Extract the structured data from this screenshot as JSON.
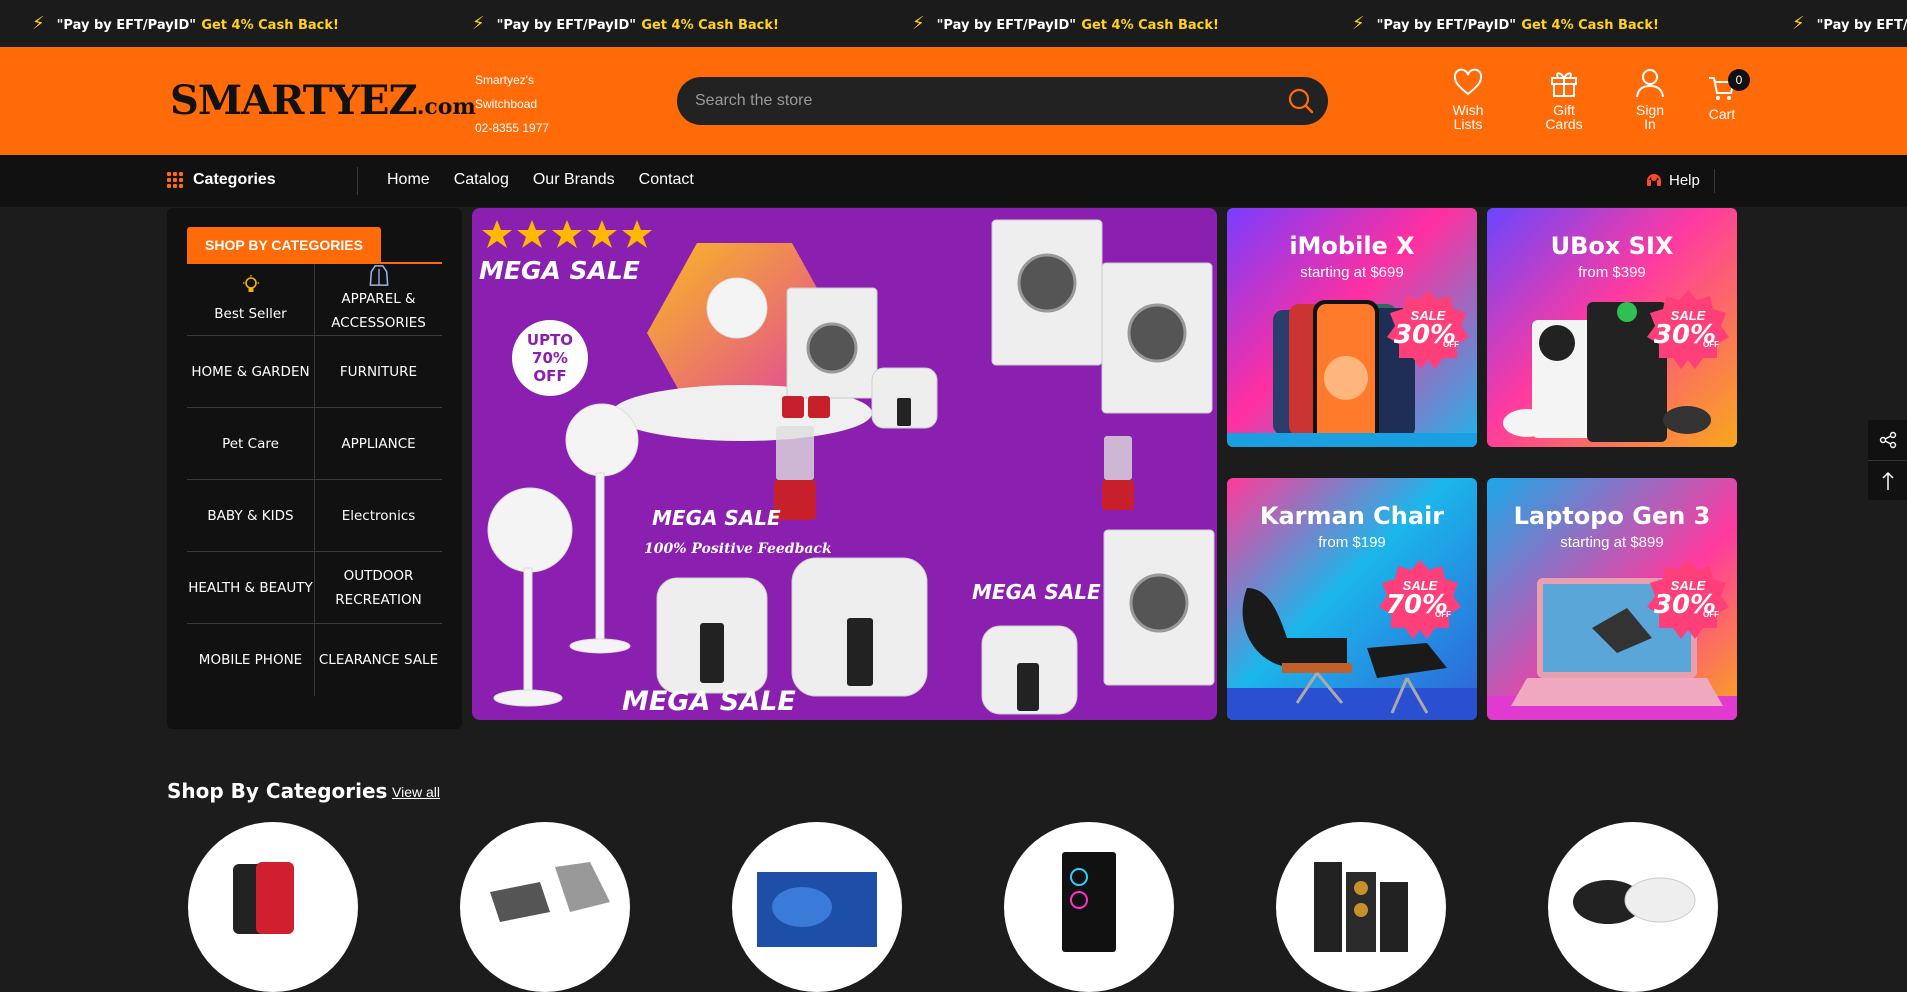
{
  "announcement": {
    "quote_text": "\"Pay by EFT/PayID\"",
    "highlight_text": "Get 4% Cash Back!"
  },
  "header": {
    "logo_main": "SMARTYEZ",
    "logo_suffix": ".com",
    "switchboard_line1": "Smartyez's",
    "switchboard_line2": "Switchboad",
    "switchboard_phone": "02-8355 1977",
    "search_placeholder": "Search the store",
    "wish_line1": "Wish",
    "wish_line2": "Lists",
    "gift_line1": "Gift",
    "gift_line2": "Cards",
    "sign_line1": "Sign",
    "sign_line2": "In",
    "cart_label": "Cart",
    "cart_count": "0"
  },
  "nav": {
    "categories_label": "Categories",
    "menu": [
      "Home",
      "Catalog",
      "Our Brands",
      "Contact"
    ],
    "help_label": "Help"
  },
  "category_panel": {
    "tab_label": "SHOP BY CATEGORIES",
    "items": [
      "Best Seller",
      "APPAREL & ACCESSORIES",
      "HOME & GARDEN",
      "FURNITURE",
      "Pet Care",
      "APPLIANCE",
      "BABY & KIDS",
      "Electronics",
      "HEALTH & BEAUTY",
      "OUTDOOR RECREATION",
      "MOBILE PHONE",
      "CLEARANCE SALE"
    ]
  },
  "hero": {
    "mega_sale": "MEGA SALE",
    "upto_line1": "UPTO",
    "upto_line2": "70%",
    "upto_line3": "OFF",
    "feedback": "100% Positive Feedback"
  },
  "promos": [
    {
      "title": "iMobile X",
      "sub": "starting at $699",
      "sale_label": "SALE",
      "sale_pct": "30%",
      "sale_off": "OFF"
    },
    {
      "title": "UBox SIX",
      "sub": "from $399",
      "sale_label": "SALE",
      "sale_pct": "30%",
      "sale_off": "OFF"
    },
    {
      "title": "Karman Chair",
      "sub": "from $199",
      "sale_label": "SALE",
      "sale_pct": "70%",
      "sale_off": "OFF"
    },
    {
      "title": "Laptopo Gen 3",
      "sub": "starting at $899",
      "sale_label": "SALE",
      "sale_pct": "30%",
      "sale_off": "OFF"
    }
  ],
  "shop_by_categories": {
    "title": "Shop By Categories",
    "view_all": "View all"
  },
  "colors": {
    "brand_orange": "#ff6b08",
    "accent_yellow": "#ffd21f",
    "dark": "#111111"
  }
}
